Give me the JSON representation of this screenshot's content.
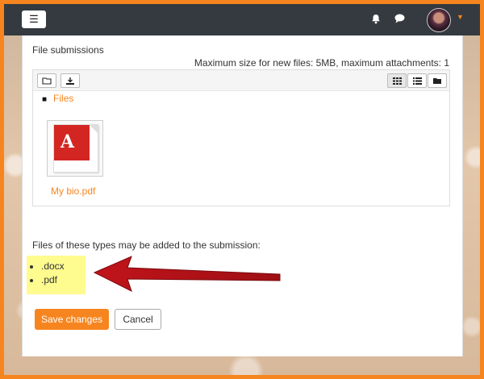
{
  "navbar": {
    "menu_icon": "☰",
    "bell_icon": "🔔",
    "chat_icon": "💬",
    "caret": "▼"
  },
  "submission": {
    "section_title": "File submissions",
    "max_size_text": "Maximum size for new files: 5MB, maximum attachments: 1",
    "breadcrumb": "Files",
    "file_name": "My bio.pdf"
  },
  "types": {
    "label": "Files of these types may be added to the submission:",
    "items": [
      ".docx",
      ".pdf"
    ]
  },
  "actions": {
    "save_label": "Save changes",
    "cancel_label": "Cancel"
  },
  "colors": {
    "accent": "#f7851f",
    "navbar": "#343a40",
    "highlight": "#fefb8f",
    "arrow": "#c0141a"
  }
}
